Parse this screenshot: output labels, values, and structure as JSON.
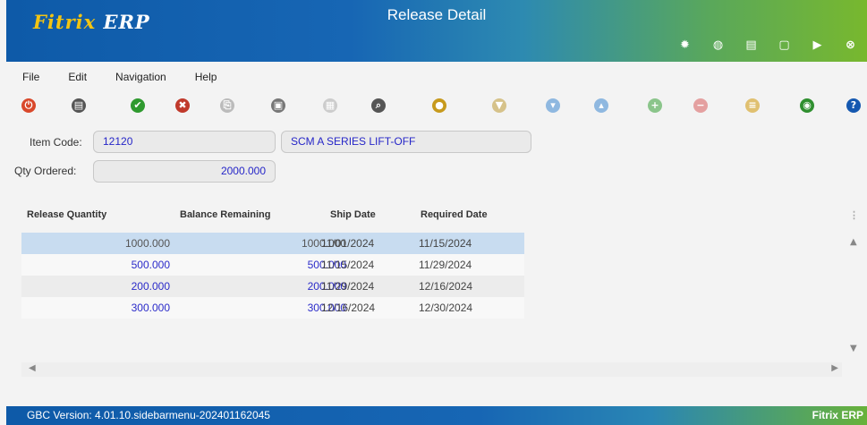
{
  "app": {
    "logo_prefix": "Fitrix",
    "logo_suffix": "ERP",
    "window_title": "Release Detail"
  },
  "title_icons": [
    "gear-icon",
    "target-icon",
    "document-icon",
    "blank-document-icon",
    "play-icon",
    "close-icon"
  ],
  "menu": [
    "File",
    "Edit",
    "Navigation",
    "Help"
  ],
  "toolbar_icons": [
    {
      "name": "power-icon",
      "color": "#d9482b",
      "glyph": "⏻"
    },
    {
      "name": "copy-windows-icon",
      "color": "#555555",
      "glyph": "▤"
    },
    {
      "name": "accept-icon",
      "color": "#2f9a2f",
      "glyph": "✔"
    },
    {
      "name": "cancel-icon",
      "color": "#c0392b",
      "glyph": "✖"
    },
    {
      "name": "copy-icon",
      "color": "#bbbbbb",
      "glyph": "⎘"
    },
    {
      "name": "paste-icon",
      "color": "#777777",
      "glyph": "▣"
    },
    {
      "name": "grid-icon",
      "color": "#cccccc",
      "glyph": "▦"
    },
    {
      "name": "zoom-icon",
      "color": "#555555",
      "glyph": "⌕"
    },
    {
      "name": "user-icon",
      "color": "#c79a1d",
      "glyph": "●"
    },
    {
      "name": "filter-icon",
      "color": "#d6c28a",
      "glyph": "▼"
    },
    {
      "name": "down-circle-icon",
      "color": "#8fb8e0",
      "glyph": "▾"
    },
    {
      "name": "up-circle-icon",
      "color": "#8fb8e0",
      "glyph": "▴"
    },
    {
      "name": "add-row-icon",
      "color": "#8bc58b",
      "glyph": "+"
    },
    {
      "name": "delete-row-icon",
      "color": "#e4a0a0",
      "glyph": "−"
    },
    {
      "name": "note-icon",
      "color": "#e0c070",
      "glyph": "≡"
    },
    {
      "name": "globe-icon",
      "color": "#2f8f2f",
      "glyph": "◉"
    },
    {
      "name": "help-icon",
      "color": "#1558b0",
      "glyph": "?"
    }
  ],
  "form": {
    "item_code_label": "Item Code:",
    "item_code": "12120",
    "item_desc": "SCM A SERIES LIFT-OFF",
    "qty_ordered_label": "Qty Ordered:",
    "qty_ordered": "2000.000"
  },
  "grid": {
    "headers": [
      "Release Quantity",
      "Balance Remaining",
      "Ship Date",
      "Required Date"
    ],
    "rows": [
      {
        "release_qty": "1000.000",
        "balance": "1000.000",
        "ship_date": "11/01/2024",
        "required_date": "11/15/2024"
      },
      {
        "release_qty": "500.000",
        "balance": "500.000",
        "ship_date": "11/15/2024",
        "required_date": "11/29/2024"
      },
      {
        "release_qty": "200.000",
        "balance": "200.000",
        "ship_date": "11/29/2024",
        "required_date": "12/16/2024"
      },
      {
        "release_qty": "300.000",
        "balance": "300.000",
        "ship_date": "12/16/2024",
        "required_date": "12/30/2024"
      }
    ]
  },
  "status": {
    "version": "GBC Version: 4.01.10.sidebarmenu-202401162045",
    "brand": "Fitrix ERP"
  }
}
